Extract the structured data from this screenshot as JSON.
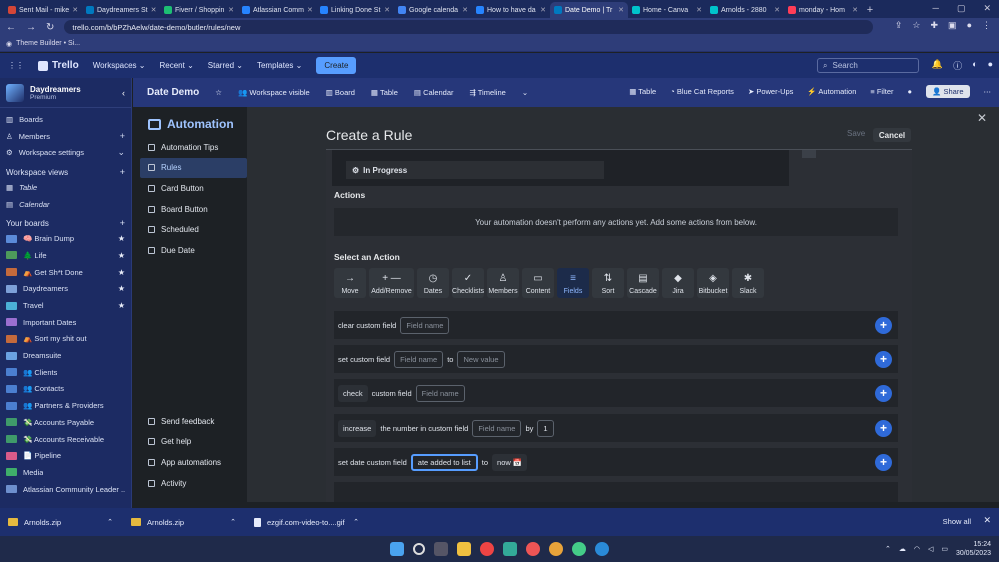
{
  "browser": {
    "tabs": [
      {
        "label": "Sent Mail - mike",
        "color": "#d44638"
      },
      {
        "label": "Daydreamers St",
        "color": "#0079bf"
      },
      {
        "label": "Fiverr / Shoppin",
        "color": "#1dbf73"
      },
      {
        "label": "Atlassian Comm",
        "color": "#2684ff"
      },
      {
        "label": "Linking Done St",
        "color": "#2684ff"
      },
      {
        "label": "Google calenda",
        "color": "#4285f4"
      },
      {
        "label": "How to have da",
        "color": "#2684ff"
      },
      {
        "label": "Date Demo | Tr",
        "color": "#0079bf",
        "active": true
      },
      {
        "label": "Home - Canva",
        "color": "#00c4cc"
      },
      {
        "label": "Arnolds - 2880",
        "color": "#00c4cc"
      },
      {
        "label": "monday - Hom",
        "color": "#ff3d57"
      }
    ],
    "url": "trello.com/b/bPZhAelw/date-demo/butler/rules/new",
    "bookmark": "Theme Builder • Si..."
  },
  "trello_header": {
    "logo": "Trello",
    "menus": [
      "Workspaces",
      "Recent",
      "Starred",
      "Templates"
    ],
    "create": "Create",
    "search_placeholder": "Search"
  },
  "sidebar": {
    "workspace_name": "Daydreamers",
    "workspace_plan": "Premium",
    "items": [
      {
        "label": "Boards",
        "plus": false
      },
      {
        "label": "Members",
        "plus": true
      },
      {
        "label": "Workspace settings",
        "plus": false
      }
    ],
    "views_title": "Workspace views",
    "views": [
      "Table",
      "Calendar"
    ],
    "boards_title": "Your boards",
    "boards": [
      {
        "label": "🧠 Brain Dump",
        "star": true,
        "color": "#5b8bd9"
      },
      {
        "label": "🌲 Life",
        "star": true,
        "color": "#4e9a5b"
      },
      {
        "label": "⛺ Get Sh*t Done",
        "star": true,
        "color": "#c46a3c"
      },
      {
        "label": "Daydreamers",
        "star": true,
        "color": "#7da0d8"
      },
      {
        "label": "Travel",
        "star": true,
        "color": "#4bb0d6"
      },
      {
        "label": "Important Dates",
        "star": false,
        "color": "#9a6fd0"
      },
      {
        "label": "⛺ Sort my shit out",
        "star": false,
        "color": "#c46a3c"
      },
      {
        "label": "Dreamsuite",
        "star": false,
        "color": "#6aa2e2"
      },
      {
        "label": "👥 Clients",
        "star": false,
        "color": "#4b7fd0"
      },
      {
        "label": "👥 Contacts",
        "star": false,
        "color": "#4b7fd0"
      },
      {
        "label": "👥 Partners & Providers",
        "star": false,
        "color": "#4b7fd0"
      },
      {
        "label": "💸 Accounts Payable",
        "star": false,
        "color": "#3f9a6a"
      },
      {
        "label": "💸 Accounts Receivable",
        "star": false,
        "color": "#3f9a6a"
      },
      {
        "label": "📄 Pipeline",
        "star": false,
        "color": "#d95b8a"
      },
      {
        "label": "Media",
        "star": false,
        "color": "#3fae6a"
      },
      {
        "label": "Atlassian Community Leader ...",
        "star": false,
        "color": "#6e8fce"
      }
    ]
  },
  "board_bar": {
    "title": "Date Demo",
    "visibility": "Workspace visible",
    "views": [
      "Board",
      "Table",
      "Calendar",
      "Timeline"
    ],
    "right": [
      "Table",
      "Blue Cat Reports",
      "Power-Ups",
      "Automation",
      "Filter"
    ],
    "share": "Share"
  },
  "butler": {
    "title": "Automation",
    "menu": [
      {
        "label": "Automation Tips",
        "active": false
      },
      {
        "label": "Rules",
        "active": true
      },
      {
        "label": "Card Button",
        "active": false
      },
      {
        "label": "Board Button",
        "active": false
      },
      {
        "label": "Scheduled",
        "active": false
      },
      {
        "label": "Due Date",
        "active": false
      }
    ],
    "bottom": [
      "Send feedback",
      "Get help",
      "App automations",
      "Activity"
    ]
  },
  "rule": {
    "title": "Create a Rule",
    "save": "Save",
    "cancel": "Cancel",
    "trigger_value": "In Progress",
    "actions_title": "Actions",
    "no_actions": "Your automation doesn't perform any actions yet. Add some actions from below.",
    "select_title": "Select an Action",
    "action_tabs": [
      {
        "label": "Move",
        "icon": "→"
      },
      {
        "label": "Add/Remove",
        "icon": "+ —",
        "wide": true
      },
      {
        "label": "Dates",
        "icon": "◷"
      },
      {
        "label": "Checklists",
        "icon": "✓"
      },
      {
        "label": "Members",
        "icon": "♙"
      },
      {
        "label": "Content",
        "icon": "▭"
      },
      {
        "label": "Fields",
        "icon": "≡",
        "active": true
      },
      {
        "label": "Sort",
        "icon": "⇅"
      },
      {
        "label": "Cascade",
        "icon": "▤"
      },
      {
        "label": "Jira",
        "icon": "◆"
      },
      {
        "label": "Bitbucket",
        "icon": "◈"
      },
      {
        "label": "Slack",
        "icon": "✱"
      }
    ],
    "rows": [
      {
        "t1": "clear custom field",
        "f1": "Field name"
      },
      {
        "t1": "set custom field",
        "f1": "Field name",
        "t2": "to",
        "f2": "New value"
      },
      {
        "c1": "check",
        "t1": "custom field",
        "f1": "Field name"
      },
      {
        "c1": "increase",
        "t1": "the number in custom field",
        "f1": "Field name",
        "t2": "by",
        "f2": "1"
      },
      {
        "t1": "set date custom field",
        "f1": "ate added to list",
        "t2": "to",
        "c2": "now 📅"
      }
    ]
  },
  "downloads": {
    "items": [
      "Arnolds.zip",
      "Arnolds.zip",
      "ezgif.com-video-to....gif"
    ],
    "show_all": "Show all"
  },
  "taskbar": {
    "time": "15:24",
    "date": "30/05/2023"
  }
}
